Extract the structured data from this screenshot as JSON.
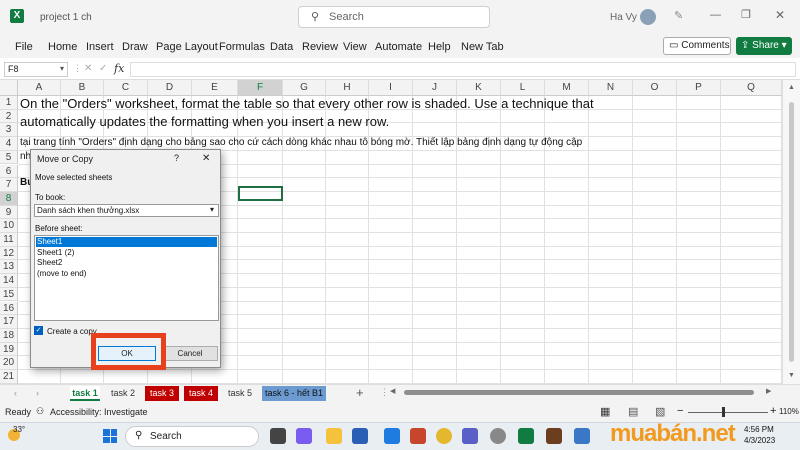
{
  "window": {
    "filename": "project 1 ch",
    "user": "Ha Vy"
  },
  "search": {
    "placeholder": "Search"
  },
  "menu": [
    "File",
    "Home",
    "Insert",
    "Draw",
    "Page Layout",
    "Formulas",
    "Data",
    "Review",
    "View",
    "Automate",
    "Help",
    "New Tab"
  ],
  "buttons": {
    "comments": "Comments",
    "share": "Share"
  },
  "namebox": "F8",
  "fx": "fx",
  "columns": [
    "A",
    "B",
    "C",
    "D",
    "E",
    "F",
    "G",
    "H",
    "I",
    "J",
    "K",
    "L",
    "M",
    "N",
    "O",
    "P",
    "Q"
  ],
  "rows": [
    "1",
    "2",
    "3",
    "4",
    "5",
    "6",
    "7",
    "8",
    "9",
    "10",
    "11",
    "12",
    "13",
    "14",
    "15",
    "16",
    "17",
    "18",
    "19",
    "20",
    "21"
  ],
  "cells": {
    "r1": "On the \"Orders\" worksheet, format the table so that every other row is shaded. Use a technique that",
    "r2": "automatically updates the formatting when you insert a new row.",
    "r4": "tại trang tính \"Orders\" định dạng cho bảng sao cho cứ cách dòng khác nhau tô bóng mờ. Thiết lập bảng định dạng tự động cập",
    "r5": "nh",
    "r7": "Bu"
  },
  "dialog": {
    "title": "Move or Copy",
    "help": "?",
    "close": "✕",
    "subtitle": "Move selected sheets",
    "to_book_label": "To book:",
    "to_book_value": "Danh sách khen thưởng.xlsx",
    "before_label": "Before sheet:",
    "before_items": [
      "Sheet1",
      "Sheet1 (2)",
      "Sheet2",
      "(move to end)"
    ],
    "create_copy_label": "Create a copy",
    "ok": "OK",
    "cancel": "Cancel"
  },
  "sheet_tabs": [
    {
      "label": "task 1",
      "active": true,
      "color": ""
    },
    {
      "label": "task 2",
      "active": false,
      "color": ""
    },
    {
      "label": "task 3",
      "active": false,
      "color": "#c00000"
    },
    {
      "label": "task 4",
      "active": false,
      "color": "#c00000"
    },
    {
      "label": "task 5",
      "active": false,
      "color": ""
    },
    {
      "label": "task 6 - hết B1",
      "active": false,
      "color": "#6b9bd1"
    }
  ],
  "status": {
    "ready": "Ready",
    "accessibility": "Accessibility: Investigate",
    "zoom": "110%"
  },
  "taskbar": {
    "temp": "33°",
    "search": "Search",
    "time": "4:56 PM",
    "date": "4/3/2023",
    "watermark": "muabán.net"
  },
  "colors": {
    "excel_green": "#107c41",
    "highlight_red": "#e8401c",
    "tab_red": "#c00000",
    "tab_blue": "#6b9bd1"
  }
}
